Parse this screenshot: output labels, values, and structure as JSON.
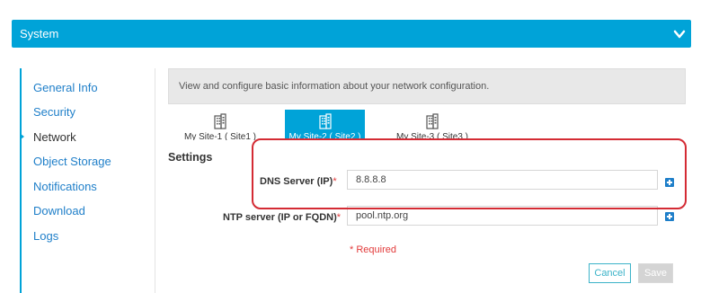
{
  "header": {
    "title": "System",
    "toggle_icon": "chevron-down-icon"
  },
  "sidebar": {
    "items": [
      {
        "label": "General Info",
        "active": false
      },
      {
        "label": "Security",
        "active": false
      },
      {
        "label": "Network",
        "active": true
      },
      {
        "label": "Object Storage",
        "active": false
      },
      {
        "label": "Notifications",
        "active": false
      },
      {
        "label": "Download",
        "active": false
      },
      {
        "label": "Logs",
        "active": false
      }
    ]
  },
  "main": {
    "info_text": "View and configure basic information about your network configuration.",
    "site_tabs": [
      {
        "label": "My Site-1 ( Site1 )",
        "icon": "building-icon",
        "active": false
      },
      {
        "label": "My Site-2 ( Site2 )",
        "icon": "building-icon",
        "active": true
      },
      {
        "label": "My Site-3 ( Site3 )",
        "icon": "building-icon",
        "active": false
      }
    ],
    "settings_title": "Settings",
    "fields": {
      "dns": {
        "label": "DNS Server (IP)",
        "required_mark": "*",
        "value": "8.8.8.8"
      },
      "ntp": {
        "label": "NTP server (IP or FQDN)",
        "required_mark": "*",
        "value": "pool.ntp.org"
      }
    },
    "required_note": "* Required",
    "buttons": {
      "cancel": "Cancel",
      "save": "Save"
    }
  },
  "colors": {
    "accent": "#00a3d8",
    "link": "#1f7fc9",
    "required": "#e23b3b",
    "annotation": "#d42b34"
  }
}
